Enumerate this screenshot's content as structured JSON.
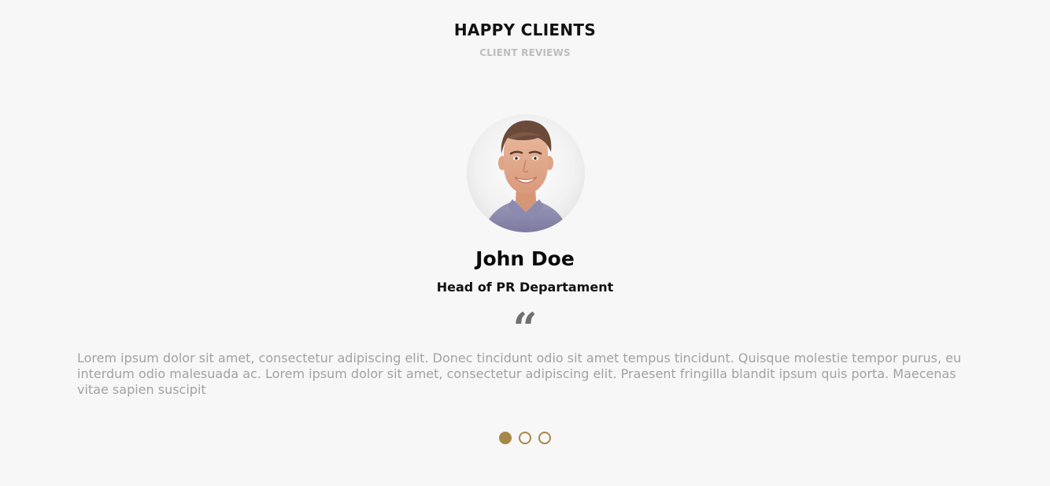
{
  "section": {
    "title": "HAPPY CLIENTS",
    "subtitle": "CLIENT REVIEWS"
  },
  "testimonial": {
    "avatar_icon": "person-photo",
    "name": "John Doe",
    "role": "Head of PR Departament",
    "quote_icon": "quote-icon",
    "quote_glyph": "“",
    "text": "Lorem ipsum dolor sit amet, consectetur adipiscing elit. Donec tincidunt odio sit amet tempus tincidunt. Quisque molestie tempor purus, eu interdum odio malesuada ac. Lorem ipsum dolor sit amet, consectetur adipiscing elit. Praesent fringilla blandit ipsum quis porta. Maecenas vitae sapien suscipit"
  },
  "pagination": {
    "total": 3,
    "active_index": 0
  },
  "colors": {
    "accent": "#a8874a",
    "background": "#f7f7f7",
    "body_text": "#a2a2a2"
  }
}
